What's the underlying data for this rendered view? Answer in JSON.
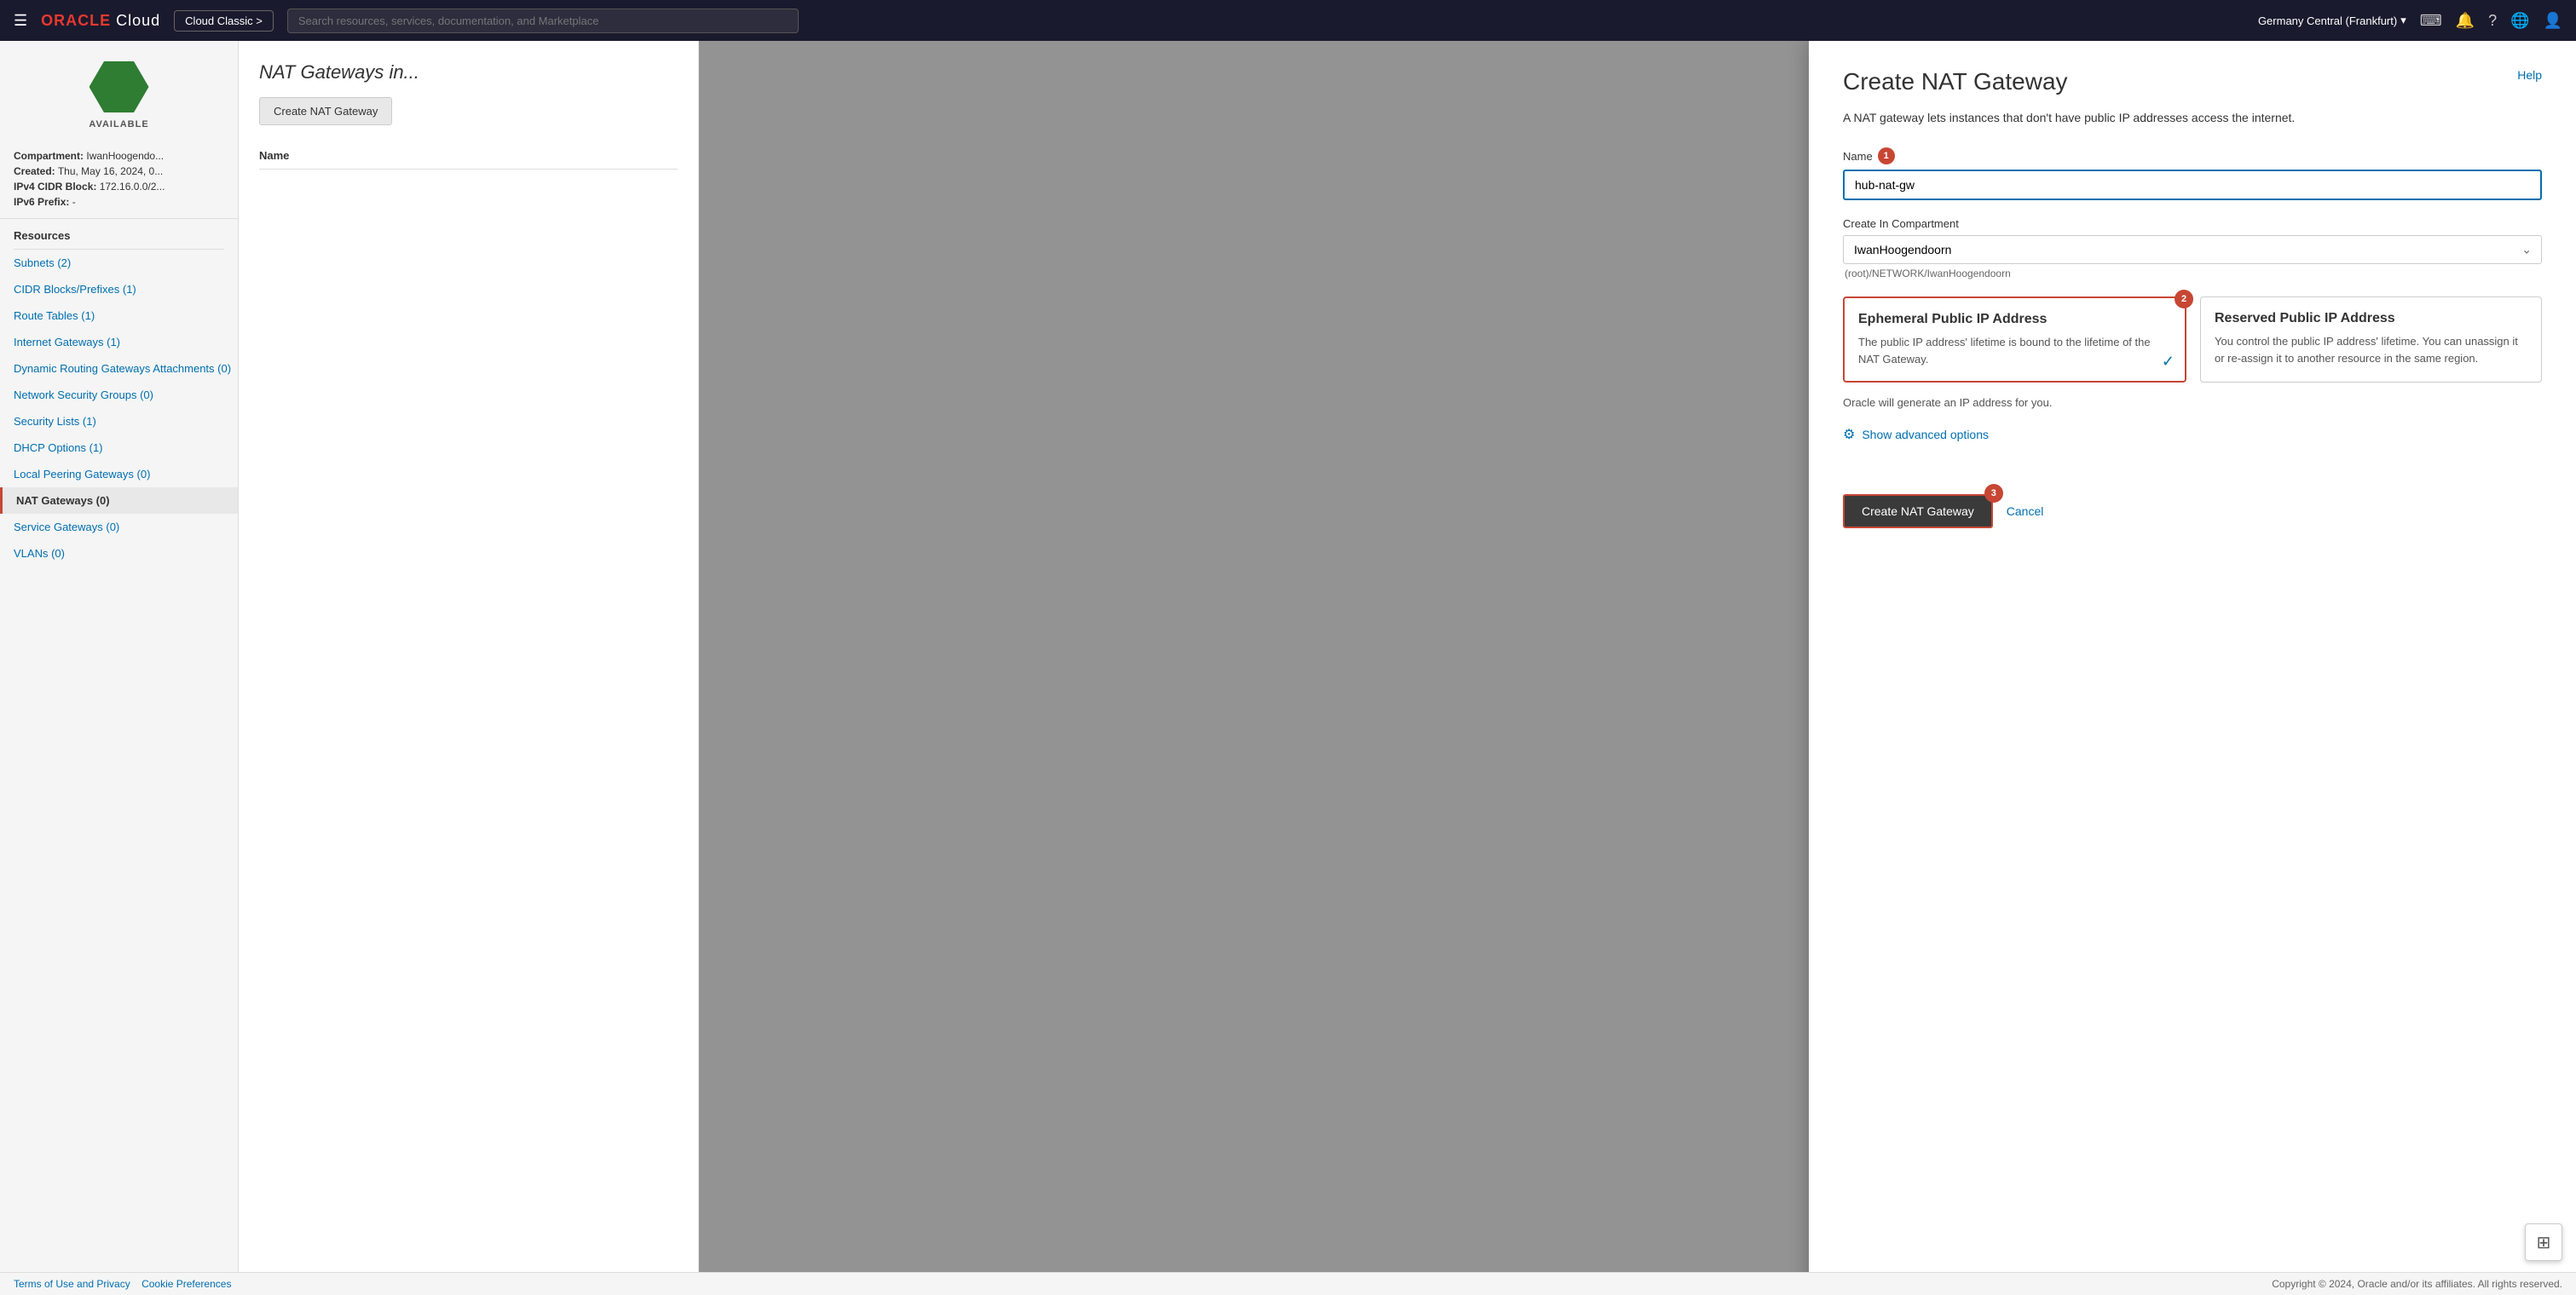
{
  "topnav": {
    "hamburger_label": "☰",
    "logo_oracle": "ORACLE",
    "logo_cloud": "Cloud",
    "classic_btn": "Cloud Classic >",
    "search_placeholder": "Search resources, services, documentation, and Marketplace",
    "region": "Germany Central (Frankfurt)",
    "region_chevron": "▾"
  },
  "vcn": {
    "status": "AVAILABLE",
    "compartment_label": "Compartment:",
    "compartment_value": "IwanHoogendo...",
    "created_label": "Created:",
    "created_value": "Thu, May 16, 2024, 0...",
    "ipv4_label": "IPv4 CIDR Block:",
    "ipv4_value": "172.16.0.0/2...",
    "ipv6_label": "IPv6 Prefix:",
    "ipv6_value": "-"
  },
  "sidebar": {
    "resources_label": "Resources",
    "items": [
      {
        "id": "subnets",
        "label": "Subnets (2)"
      },
      {
        "id": "cidr",
        "label": "CIDR Blocks/Prefixes (1)"
      },
      {
        "id": "route-tables",
        "label": "Route Tables (1)"
      },
      {
        "id": "internet-gateways",
        "label": "Internet Gateways (1)"
      },
      {
        "id": "dynamic-routing",
        "label": "Dynamic Routing Gateways Attachments (0)"
      },
      {
        "id": "network-security",
        "label": "Network Security Groups (0)"
      },
      {
        "id": "security-lists",
        "label": "Security Lists (1)"
      },
      {
        "id": "dhcp-options",
        "label": "DHCP Options (1)"
      },
      {
        "id": "local-peering",
        "label": "Local Peering Gateways (0)"
      },
      {
        "id": "nat-gateways",
        "label": "NAT Gateways (0)",
        "active": true
      },
      {
        "id": "service-gateways",
        "label": "Service Gateways (0)"
      },
      {
        "id": "vlans",
        "label": "VLANs (0)"
      }
    ]
  },
  "nat_panel": {
    "title": "NAT Gateways",
    "title_suffix": "in...",
    "create_btn": "Create NAT Gateway",
    "table_header": "Name"
  },
  "dialog": {
    "title": "Create NAT Gateway",
    "help_link": "Help",
    "description": "A NAT gateway lets instances that don't have public IP addresses access the internet.",
    "name_label": "Name",
    "name_badge": "1",
    "name_value": "hub-nat-gw",
    "compartment_label": "Create In Compartment",
    "compartment_value": "IwanHoogendoorn",
    "compartment_hint": "(root)/NETWORK/IwanHoogendoorn",
    "ip_section_badge": "2",
    "ephemeral_title": "Ephemeral Public IP Address",
    "ephemeral_desc": "The public IP address' lifetime is bound to the lifetime of the NAT Gateway.",
    "ephemeral_check": "✓",
    "reserved_title": "Reserved Public IP Address",
    "reserved_desc": "You control the public IP address' lifetime. You can unassign it or re-assign it to another resource in the same region.",
    "oracle_generate": "Oracle will generate an IP address for you.",
    "show_advanced": "Show advanced options",
    "create_btn": "Create NAT Gateway",
    "create_badge": "3",
    "cancel_btn": "Cancel"
  },
  "footer": {
    "terms": "Terms of Use and Privacy",
    "cookies": "Cookie Preferences",
    "copyright": "Copyright © 2024, Oracle and/or its affiliates. All rights reserved."
  }
}
